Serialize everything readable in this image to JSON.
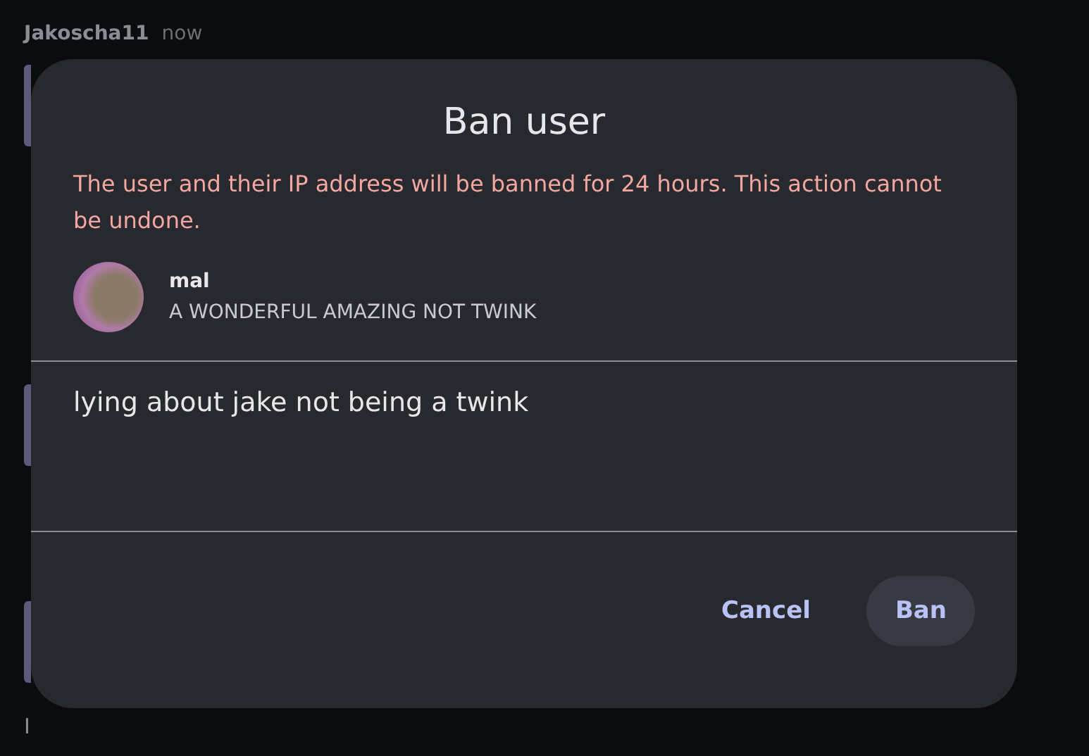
{
  "chat": {
    "author": "Jakoscha11",
    "time": "now",
    "items": [
      {
        "kind": "bar"
      },
      {
        "kind": "bar"
      },
      {
        "kind": "bar"
      },
      {
        "kind": "text",
        "text": "I"
      }
    ]
  },
  "dialog": {
    "title": "Ban user",
    "warning": "The user and their IP address will be banned for 24 hours. This action cannot be undone.",
    "user": {
      "name": "mal",
      "subtitle": "A WONDERFUL AMAZING NOT TWINK"
    },
    "reason": {
      "value": "lying about jake not being a twink"
    },
    "buttons": [
      {
        "label": "Cancel",
        "kind": "text"
      },
      {
        "label": "Ban",
        "kind": "filled"
      }
    ]
  }
}
